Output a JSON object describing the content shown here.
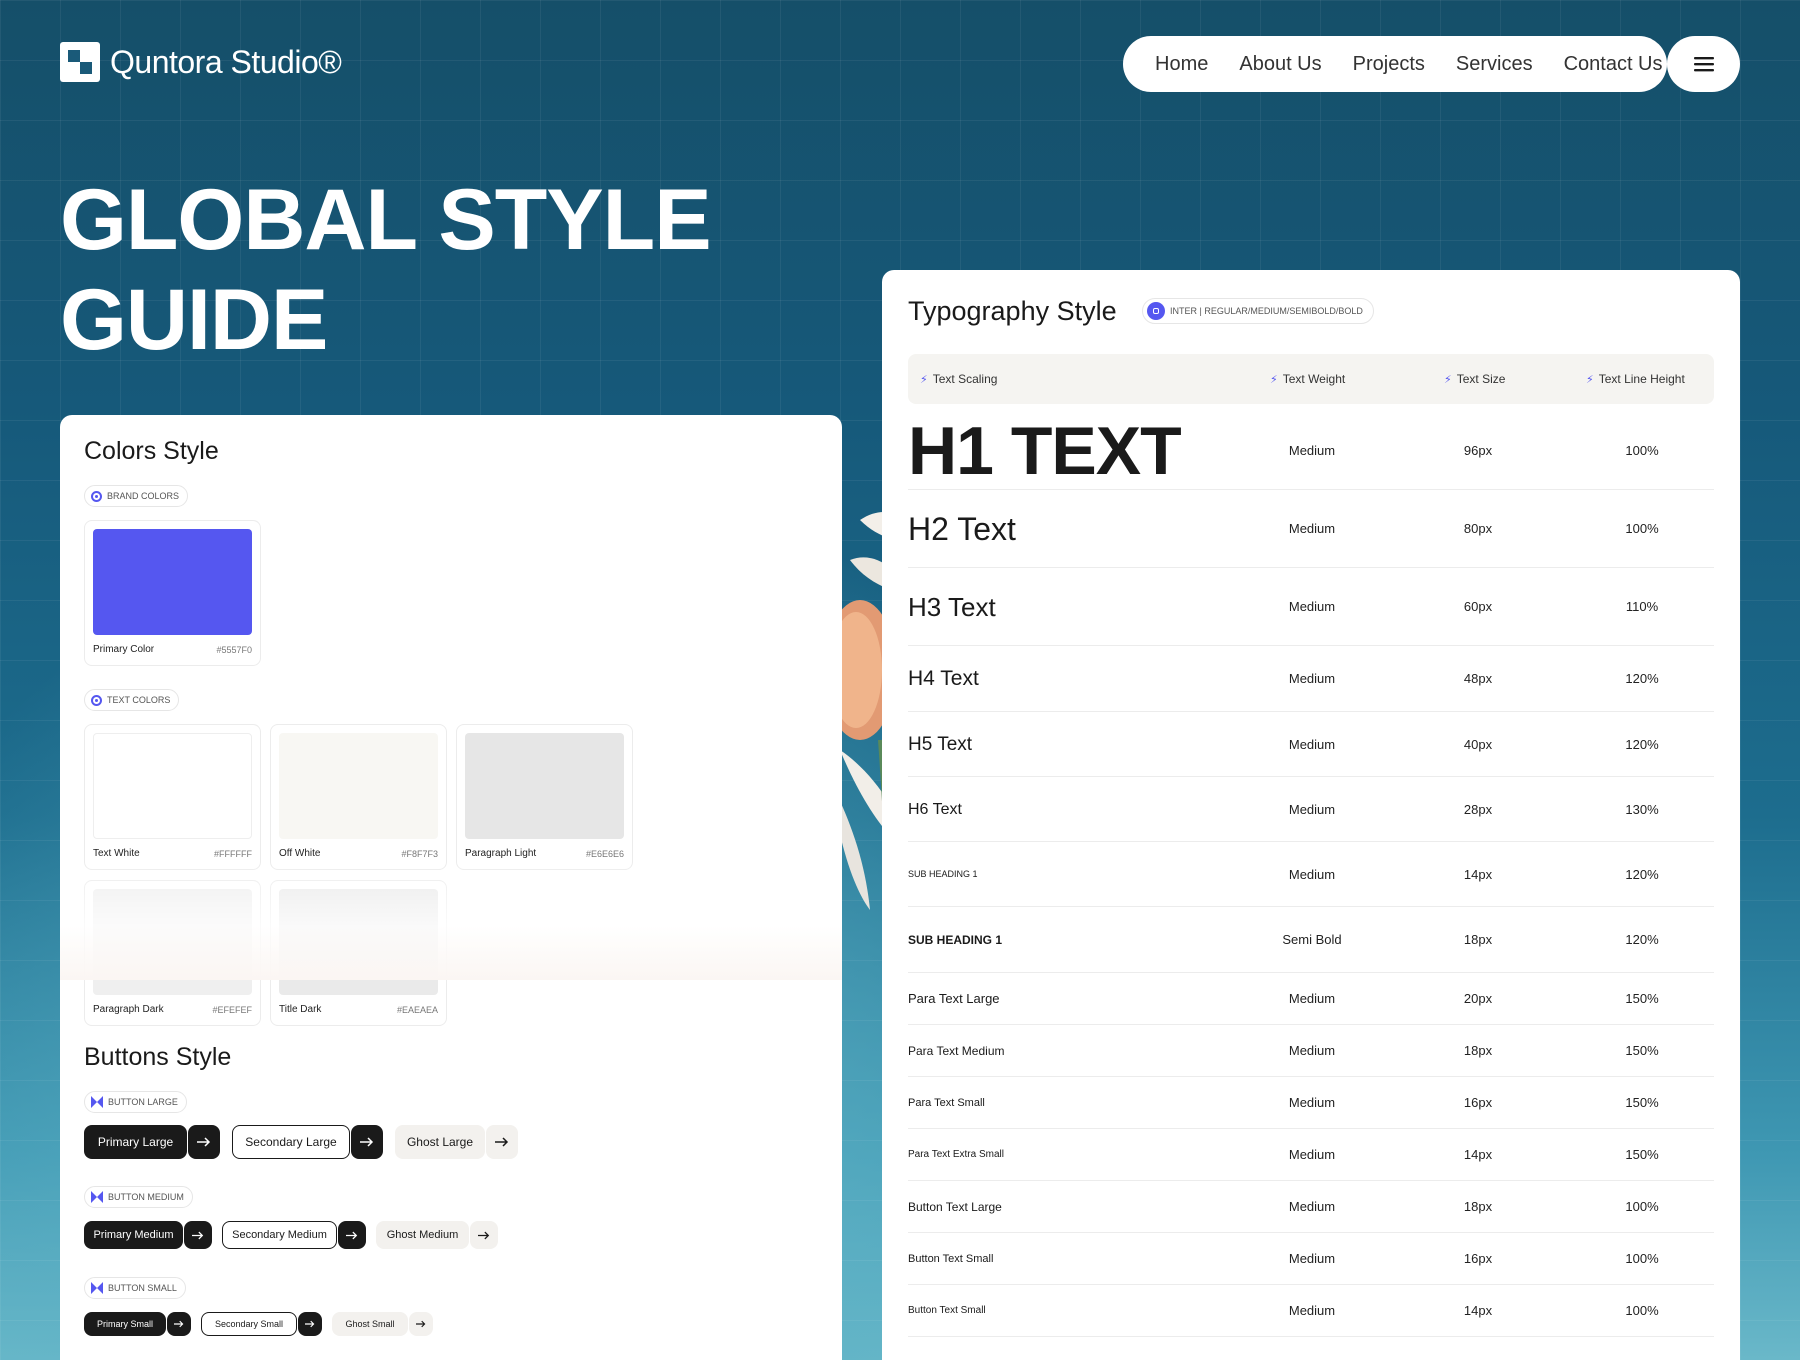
{
  "brand": {
    "name": "Quntora Studio®"
  },
  "nav": {
    "items": [
      "Home",
      "About Us",
      "Projects",
      "Services",
      "Contact Us"
    ],
    "menu_icon": "hamburger-icon"
  },
  "hero": {
    "title_line1": "GLOBAL STYLE",
    "title_line2": "GUIDE"
  },
  "colors": {
    "title": "Colors Style",
    "brand_label": "BRAND COLORS",
    "text_label": "TEXT COLORS",
    "brand_colors": [
      {
        "name": "Primary Color",
        "hex": "#5557F0",
        "display_hex": "#5557F0"
      }
    ],
    "text_colors": [
      {
        "name": "Text White",
        "hex": "#FFFFFF",
        "display_hex": "#FFFFFF"
      },
      {
        "name": "Off White",
        "hex": "#F8F7F3",
        "display_hex": "#F8F7F3"
      },
      {
        "name": "Paragraph Light",
        "hex": "#E6E6E6",
        "display_hex": "#E6E6E6"
      },
      {
        "name": "Paragraph Dark",
        "hex": "#EFEFEF",
        "display_hex": "#EFEFEF"
      },
      {
        "name": "Title Dark",
        "hex": "#EAEAEA",
        "display_hex": "#EAEAEA"
      }
    ]
  },
  "buttons": {
    "title": "Buttons Style",
    "large_label": "BUTTON LARGE",
    "medium_label": "BUTTON MEDIUM",
    "small_label": "BUTTON SMALL",
    "large": {
      "primary": "Primary Large",
      "secondary": "Secondary Large",
      "ghost": "Ghost Large"
    },
    "medium": {
      "primary": "Primary Medium",
      "secondary": "Secondary Medium",
      "ghost": "Ghost Medium"
    },
    "small": {
      "primary": "Primary Small",
      "secondary": "Secondary Small",
      "ghost": "Ghost Small"
    }
  },
  "typography": {
    "title": "Typography Style",
    "font_badge": "INTER | REGULAR/MEDIUM/SEMIBOLD/BOLD",
    "headers": [
      "Text Scaling",
      "Text Weight",
      "Text Size",
      "Text Line Height"
    ],
    "rows": [
      {
        "name": "H1 TEXT",
        "weight": "Medium",
        "size": "96px",
        "line_height": "100%"
      },
      {
        "name": "H2 Text",
        "weight": "Medium",
        "size": "80px",
        "line_height": "100%"
      },
      {
        "name": "H3 Text",
        "weight": "Medium",
        "size": "60px",
        "line_height": "110%"
      },
      {
        "name": "H4 Text",
        "weight": "Medium",
        "size": "48px",
        "line_height": "120%"
      },
      {
        "name": "H5 Text",
        "weight": "Medium",
        "size": "40px",
        "line_height": "120%"
      },
      {
        "name": "H6 Text",
        "weight": "Medium",
        "size": "28px",
        "line_height": "130%"
      },
      {
        "name": "SUB HEADING 1",
        "weight": "Medium",
        "size": "14px",
        "line_height": "120%"
      },
      {
        "name": "SUB HEADING 1",
        "weight": "Semi Bold",
        "size": "18px",
        "line_height": "120%"
      },
      {
        "name": "Para Text Large",
        "weight": "Medium",
        "size": "20px",
        "line_height": "150%"
      },
      {
        "name": "Para Text Medium",
        "weight": "Medium",
        "size": "18px",
        "line_height": "150%"
      },
      {
        "name": "Para Text Small",
        "weight": "Medium",
        "size": "16px",
        "line_height": "150%"
      },
      {
        "name": "Para Text Extra Small",
        "weight": "Medium",
        "size": "14px",
        "line_height": "150%"
      },
      {
        "name": "Button Text Large",
        "weight": "Medium",
        "size": "18px",
        "line_height": "100%"
      },
      {
        "name": "Button Text Small",
        "weight": "Medium",
        "size": "16px",
        "line_height": "100%"
      },
      {
        "name": "Button Text Small",
        "weight": "Medium",
        "size": "14px",
        "line_height": "100%"
      }
    ]
  }
}
